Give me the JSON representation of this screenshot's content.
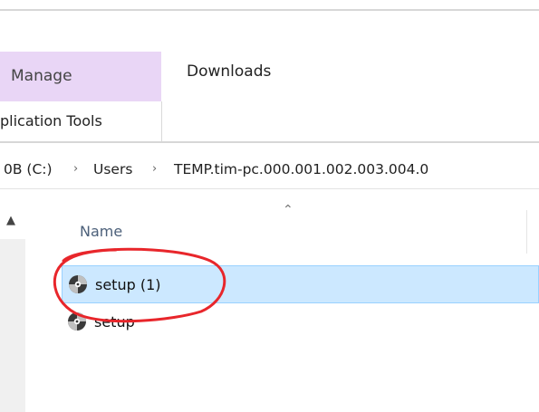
{
  "ribbon": {
    "context_tab": "Manage",
    "tab": "Downloads",
    "context_group": "plication Tools"
  },
  "address": {
    "crumbs": [
      "0B (C:)",
      "Users",
      "TEMP.tim-pc.000.001.002.003.004.0"
    ],
    "separator": "›"
  },
  "file_list": {
    "column_header": "Name",
    "rows": [
      {
        "name": "setup (1)",
        "selected": true,
        "icon": "setup-disc-icon"
      },
      {
        "name": "setup",
        "selected": false,
        "icon": "setup-disc-icon"
      }
    ]
  },
  "colors": {
    "context_tab_bg": "#e9d6f6",
    "selection_bg": "#cce8ff",
    "selection_border": "#99d1ff",
    "annotation_red": "#e8262b"
  }
}
